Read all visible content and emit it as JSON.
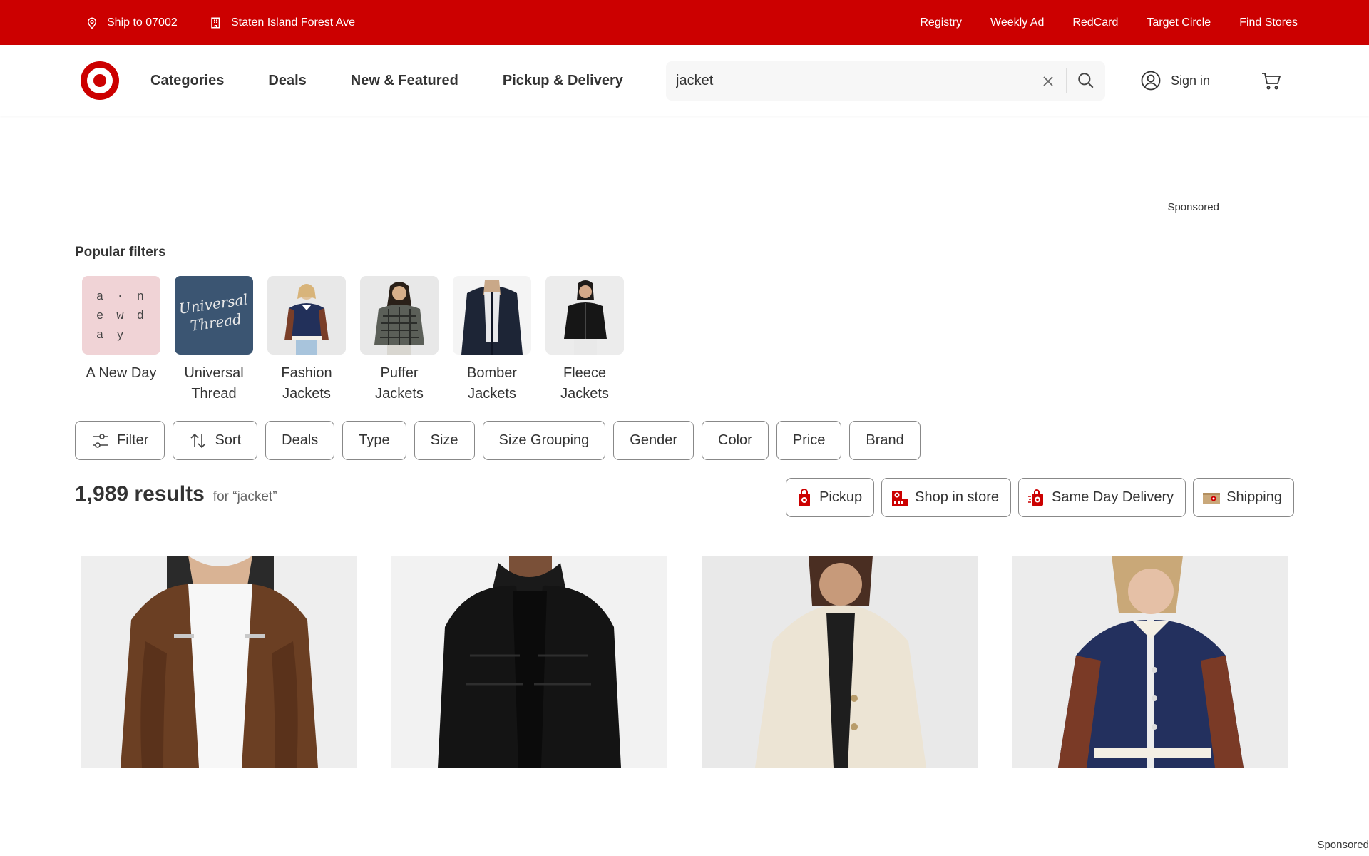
{
  "utility_bar": {
    "ship_to": "Ship to 07002",
    "store": "Staten Island Forest Ave",
    "links": [
      "Registry",
      "Weekly Ad",
      "RedCard",
      "Target Circle",
      "Find Stores"
    ]
  },
  "header": {
    "nav": [
      "Categories",
      "Deals",
      "New & Featured",
      "Pickup & Delivery"
    ],
    "search_value": "jacket",
    "sign_in": "Sign in"
  },
  "sponsored_top": "Sponsored",
  "popular_filters": {
    "title": "Popular filters",
    "items": [
      {
        "label": "A New Day",
        "thumb_text": "a · n e w d a y"
      },
      {
        "label": "Universal Thread",
        "thumb_text": "Universal Thread"
      },
      {
        "label": "Fashion Jackets"
      },
      {
        "label": "Puffer Jackets"
      },
      {
        "label": "Bomber Jackets"
      },
      {
        "label": "Fleece Jackets"
      }
    ]
  },
  "filter_chips": [
    "Filter",
    "Sort",
    "Deals",
    "Type",
    "Size",
    "Size Grouping",
    "Gender",
    "Color",
    "Price",
    "Brand"
  ],
  "results": {
    "count": "1,989 results",
    "query": "for “jacket”"
  },
  "fulfillment": [
    "Pickup",
    "Shop in store",
    "Same Day Delivery",
    "Shipping"
  ],
  "sponsored_bottom": "Sponsored",
  "colors": {
    "brand_red": "#cc0000",
    "text": "#333333"
  }
}
